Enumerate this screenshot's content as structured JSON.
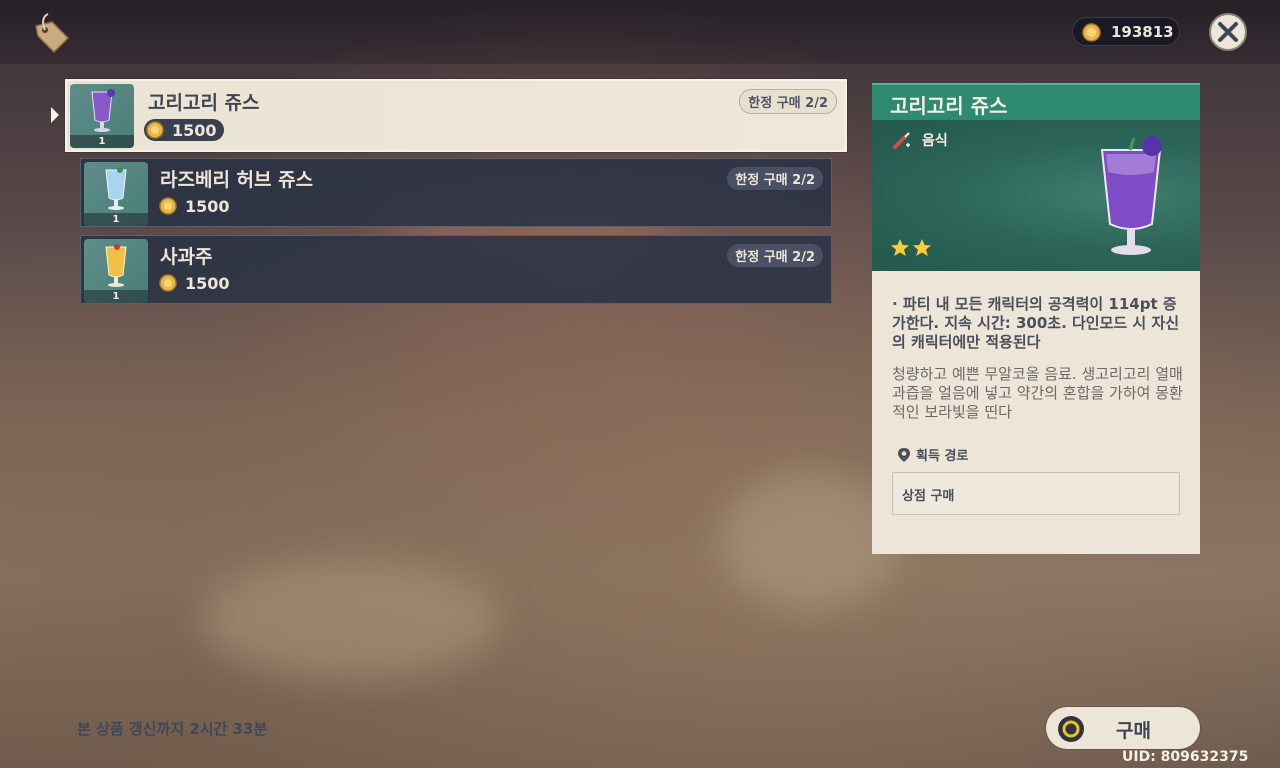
{
  "header": {
    "currency_value": "193813"
  },
  "shop_items": [
    {
      "name": "고리고리 쥬스",
      "price": "1500",
      "limit": "한정 구매 2/2",
      "qty": "1",
      "selected": true
    },
    {
      "name": "라즈베리 허브 쥬스",
      "price": "1500",
      "limit": "한정 구매 2/2",
      "qty": "1",
      "selected": false
    },
    {
      "name": "사과주",
      "price": "1500",
      "limit": "한정 구매 2/2",
      "qty": "1",
      "selected": false
    }
  ],
  "detail": {
    "title": "고리고리 쥬스",
    "type_label": "음식",
    "stars": 2,
    "effect": "· 파티 내 모든 캐릭터의 공격력이 114pt 증가한다. 지속 시간: 300초. 다인모드 시 자신의 캐릭터에만 적용된다",
    "description": "청량하고 예쁜 무알코올 음료. 생고리고리 열매 과즙을 얼음에 넣고 약간의 혼합을 가하여 몽환적인 보라빛을 띤다",
    "source_heading": "획득 경로",
    "source_value": "상점 구매"
  },
  "footer": {
    "refresh_note": "본 상품 갱신까지 2시간 33분",
    "buy_label": "구매",
    "uid": "UID: 809632375"
  },
  "icons": {
    "shop": "price-tag-icon",
    "close": "close-icon",
    "coin": "mora-coin-icon",
    "food": "food-category-icon",
    "location": "location-pin-icon",
    "buy": "confirm-circle-icon"
  },
  "colors": {
    "detail_header": "#2f8a72",
    "panel_bg": "#ece5d8",
    "row_bg": "#2a3244",
    "star": "#ffcc33"
  }
}
